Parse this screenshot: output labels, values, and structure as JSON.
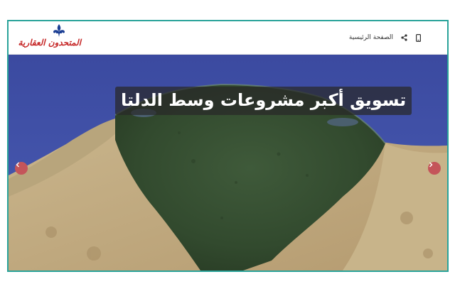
{
  "colors": {
    "frame_border": "#2aa39a",
    "nav_text": "#333333",
    "caption_bg": "#282828",
    "arrow_bg": "#c4555a",
    "logo_red": "#c62828",
    "logo_blue": "#1c3f94"
  },
  "header": {
    "logo_text": "المتحدون العقارية",
    "logo_icon": "fleur-de-lis-icon",
    "nav_home": "الصفحة الرئيسية",
    "share_icon": "share-icon",
    "mobile_icon": "mobile-icon"
  },
  "hero": {
    "image": "satellite-map-nile-delta",
    "caption": "تسويق أكبر مشروعات وسط الدلتا",
    "prev_icon": "chevron-left-icon",
    "next_icon": "chevron-right-icon"
  }
}
